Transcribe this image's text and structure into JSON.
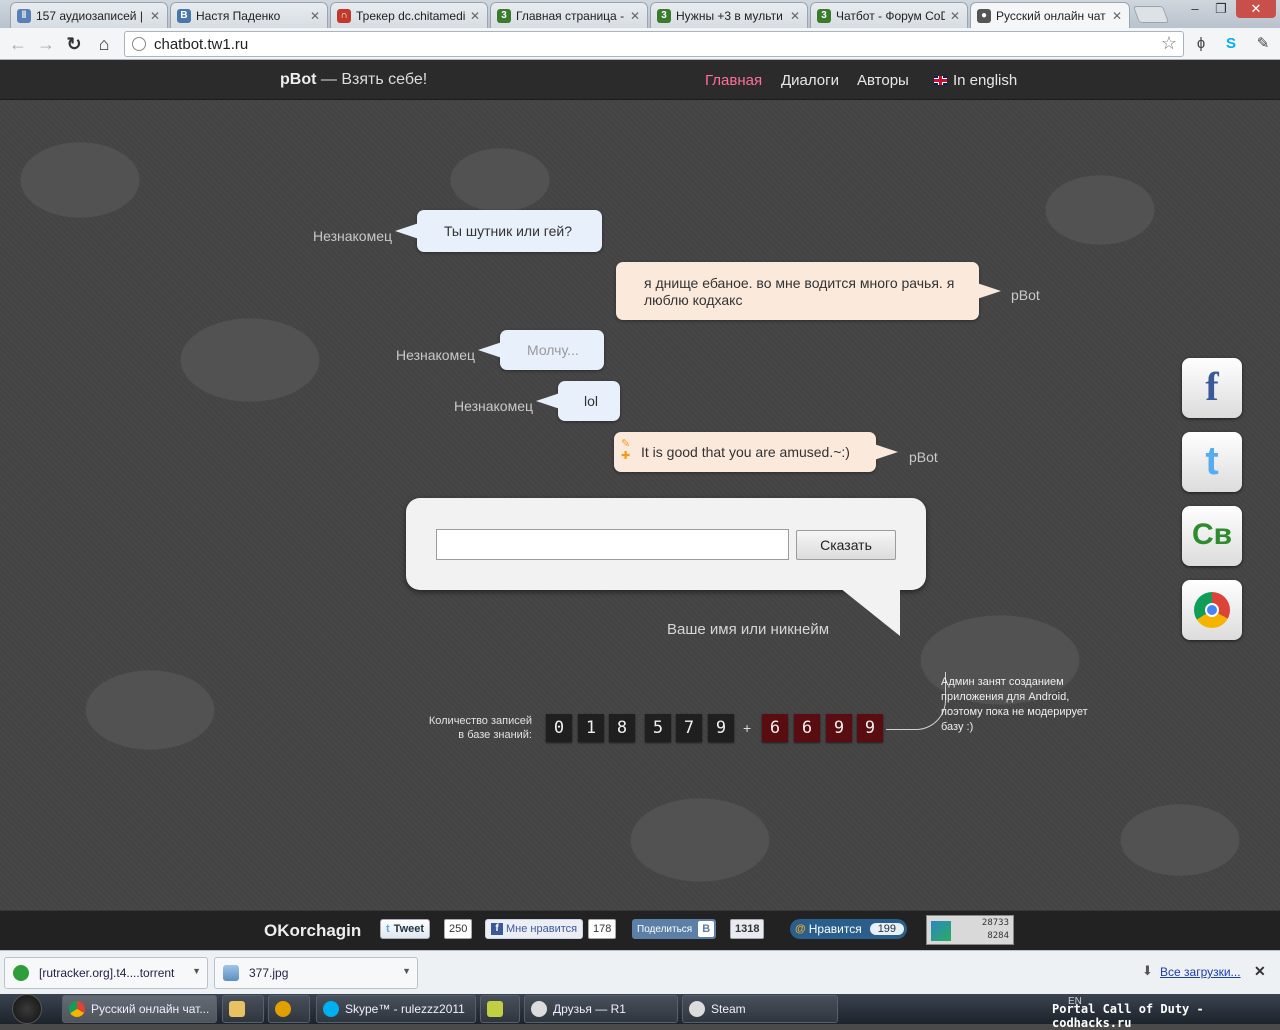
{
  "browser": {
    "tabs": [
      {
        "title": "157 аудиозаписей | ",
        "icon": "pause-icon",
        "color": "#5a7fb5"
      },
      {
        "title": "Настя Паденко",
        "icon": "vk-icon",
        "color": "#4a76a8"
      },
      {
        "title": "Трекер dc.chitamedi",
        "icon": "magnet-icon",
        "color": "#c0392b"
      },
      {
        "title": "Главная страница - ",
        "icon": "forum-icon",
        "color": "#3c7a2e"
      },
      {
        "title": "Нужны +3 в мульти",
        "icon": "forum-icon",
        "color": "#3c7a2e"
      },
      {
        "title": "Чатбот - Форум CoD",
        "icon": "forum-icon",
        "color": "#3c7a2e"
      },
      {
        "title": "Русский онлайн чат",
        "icon": "pbot-icon",
        "color": "#555555"
      }
    ],
    "url": "chatbot.tw1.ru"
  },
  "site": {
    "brand": "pBot",
    "tagline": " — Взять себе!",
    "nav": [
      {
        "label": "Главная",
        "active": true
      },
      {
        "label": "Диалоги",
        "active": false
      },
      {
        "label": "Авторы",
        "active": false
      },
      {
        "label": "In english",
        "active": false
      }
    ]
  },
  "chat": [
    {
      "side": "user",
      "speaker": "Незнакомец",
      "text": "Ты  шутник или гей?"
    },
    {
      "side": "bot",
      "speaker": "pBot",
      "text": "я днище ебаное. во мне водится много рачья. я люблю кодхакс"
    },
    {
      "side": "user",
      "speaker": "Незнакомец",
      "text": "Молчу..."
    },
    {
      "side": "user",
      "speaker": "Незнакомец",
      "text": "lol"
    },
    {
      "side": "bot",
      "speaker": "pBot",
      "text": "It is good that you are amused.~:)"
    }
  ],
  "form": {
    "message_value": "",
    "say_button": "Сказать",
    "nickname_hint": "Ваше имя или никнейм"
  },
  "counter": {
    "label": "Количество записей в базе знаний:",
    "main_digits": [
      "0",
      "1",
      "8",
      "5",
      "7",
      "9"
    ],
    "plus": "+",
    "pending_digits": [
      "6",
      "6",
      "9",
      "9"
    ],
    "note": "Админ занят созданием приложения для Android, поэтому пока не модерирует базу :)"
  },
  "social_sidebar": [
    {
      "name": "facebook",
      "glyph": "f",
      "color": "#3b5998"
    },
    {
      "name": "twitter",
      "glyph": "t",
      "color": "#55acee"
    },
    {
      "name": "cb",
      "glyph": "Cв",
      "color": "#2e8b2e"
    },
    {
      "name": "chrome",
      "glyph": "",
      "color": "#db4437"
    }
  ],
  "footer": {
    "author": "OKorchagin",
    "tweet_label": "Tweet",
    "tweet_count": "250",
    "fb_label": "Мне нравится",
    "fb_count": "178",
    "vk_share_label": "Поделиться",
    "vk_share_count": "1318",
    "like_label": "Нравится",
    "like_count": "199",
    "counter_top": "28733",
    "counter_bottom": "8284"
  },
  "downloads": {
    "items": [
      "[rutracker.org].t4....torrent",
      "377.jpg"
    ],
    "all_label": "Все загрузки..."
  },
  "taskbar": {
    "tasks": [
      {
        "label": "Русский онлайн чат...",
        "active": true
      },
      {
        "label": "",
        "active": false
      },
      {
        "label": "",
        "active": false
      },
      {
        "label": "Skype™ - rulezzz2011",
        "active": false
      },
      {
        "label": "",
        "active": false
      },
      {
        "label": "Друзья — R1",
        "active": false
      },
      {
        "label": "Steam",
        "active": false
      }
    ],
    "lang": "EN",
    "watermark": "Portal Call of Duty - codhacks.ru"
  }
}
